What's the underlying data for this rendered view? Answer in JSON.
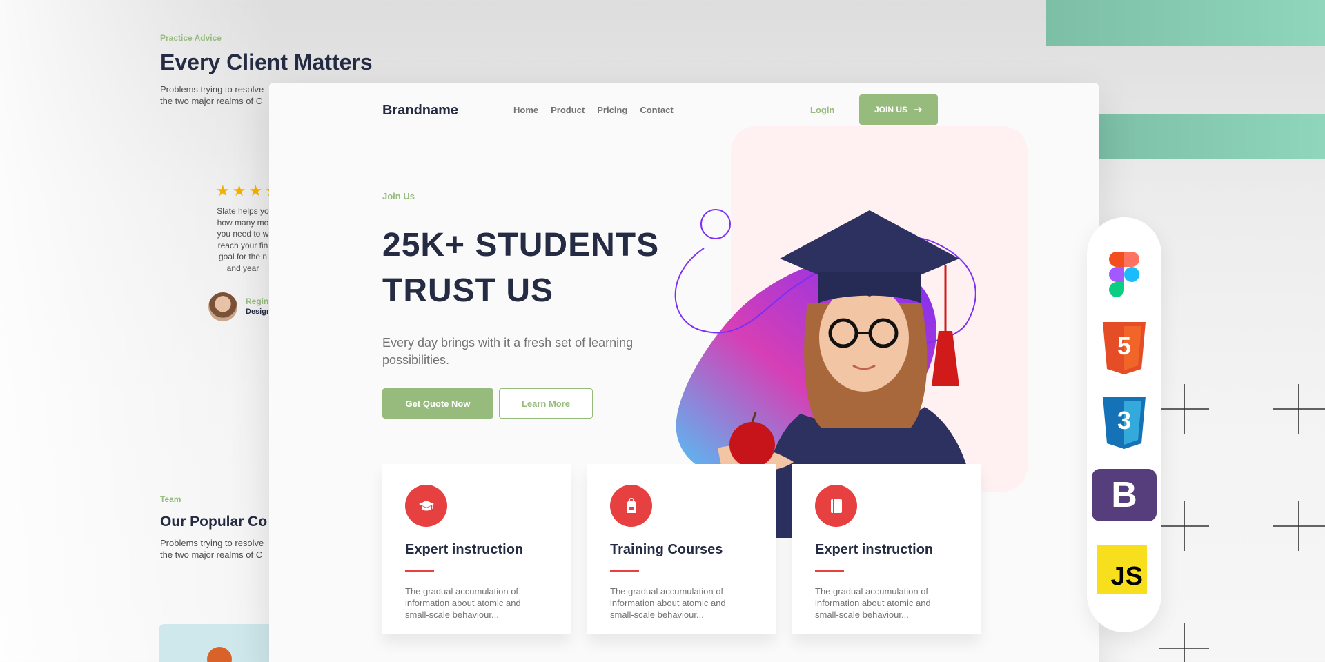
{
  "background_page": {
    "eyebrow": "Practice Advice",
    "title": "Every Client Matters",
    "desc_line1": "Problems trying to resolve",
    "desc_line2": "the two major realms of C",
    "stars": "★★★★",
    "testimonial_lines": [
      "Slate helps yo",
      "how many mo",
      "you need to w",
      "reach your fin",
      "goal for the n",
      "and year"
    ],
    "reviewer_name": "Regin",
    "reviewer_role": "Design",
    "team_eyebrow": "Team",
    "team_title": "Our Popular Co",
    "team_desc_line1": "Problems trying to resolve",
    "team_desc_line2": "the two major realms of C"
  },
  "header": {
    "brand": "Brandname",
    "nav": [
      "Home",
      "Product",
      "Pricing",
      "Contact"
    ],
    "login": "Login",
    "join_label": "JOIN US",
    "join_icon": "arrow-right-icon"
  },
  "hero": {
    "eyebrow": "Join Us",
    "title_line1": "25K+ STUDENTS",
    "title_line2": "TRUST US",
    "subtitle_line1": "Every day brings with it a fresh set of learning",
    "subtitle_line2": "possibilities.",
    "primary_button": "Get Quote Now",
    "secondary_button": "Learn More"
  },
  "features": [
    {
      "icon": "graduation-cap-icon",
      "title": "Expert instruction",
      "text": [
        "The gradual accumulation of",
        "information about atomic and",
        "small-scale behaviour..."
      ]
    },
    {
      "icon": "backpack-icon",
      "title": "Training Courses",
      "text": [
        "The gradual accumulation of",
        "information about atomic and",
        "small-scale behaviour..."
      ]
    },
    {
      "icon": "book-icon",
      "title": "Expert instruction",
      "text": [
        "The gradual accumulation of",
        "information about atomic and",
        "small-scale behaviour..."
      ]
    }
  ],
  "tech_stack": {
    "icons": [
      "figma-icon",
      "html5-icon",
      "css3-icon",
      "bootstrap-icon",
      "javascript-icon"
    ],
    "html5_label": "5",
    "css3_label": "3",
    "bootstrap_label": "B",
    "js_label": "JS"
  },
  "colors": {
    "accent_green": "#96bb7c",
    "feature_red": "#e74040",
    "heading_dark": "#252b42",
    "text_gray": "#737373",
    "teal_bar": "#8fd6bc"
  }
}
